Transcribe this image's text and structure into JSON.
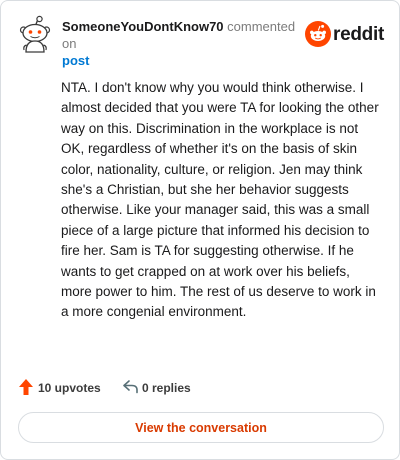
{
  "header": {
    "username": "SomeoneYouDontKnow70",
    "action_text": "commented on",
    "post_label": "post",
    "logo_text": "reddit"
  },
  "comment": {
    "text": "NTA. I don't know why you would think otherwise. I almost decided that you were TA for looking the other way on this. Discrimination in the workplace is not OK, regardless of whether it's on the basis of skin color, nationality, culture, or religion. Jen may think she's a Christian, but she her behavior suggests otherwise. Like your manager said, this was a small piece of a large picture that informed his decision to fire her. Sam is TA for suggesting otherwise. If he wants to get crapped on at work over his beliefs, more power to him. The rest of us deserve to work in a more congenial environment."
  },
  "actions": {
    "upvotes_label": "10 upvotes",
    "replies_label": "0 replies"
  },
  "footer": {
    "view_button_label": "View the conversation"
  },
  "colors": {
    "brand_orange": "#ff4500",
    "link_blue": "#0079d3",
    "button_text": "#d93a00"
  },
  "icons": [
    "snoo-avatar-icon",
    "reddit-logo-icon",
    "upvote-arrow-icon",
    "reply-arrow-icon"
  ]
}
